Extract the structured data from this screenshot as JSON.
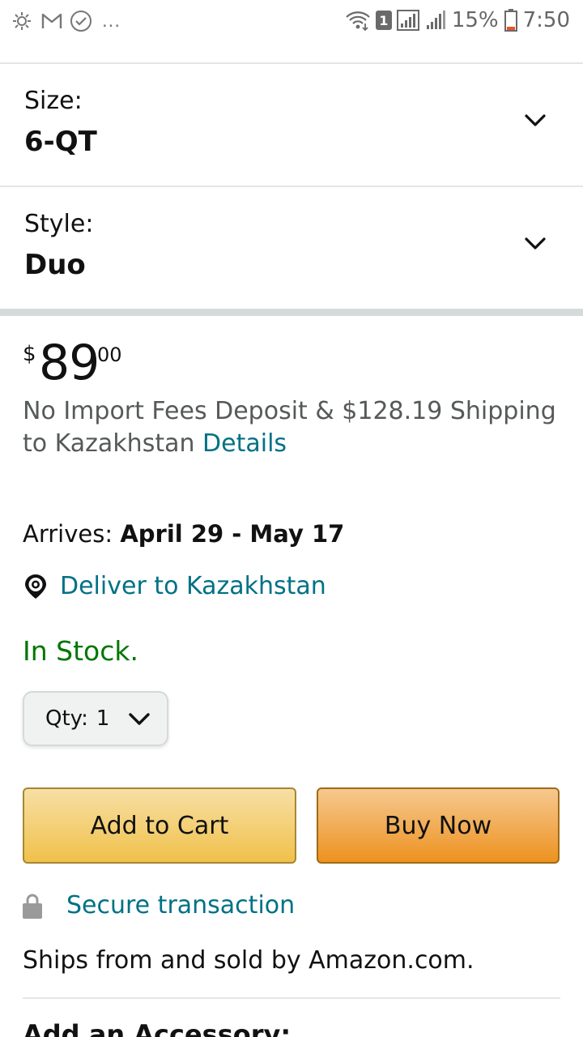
{
  "status_bar": {
    "notification_icons": [
      "weather-icon",
      "gmail-icon",
      "check-circle-icon"
    ],
    "overflow": "...",
    "sim_badge": "1",
    "battery_percent": "15%",
    "time": "7:50"
  },
  "size": {
    "label": "Size:",
    "value": "6-QT"
  },
  "style": {
    "label": "Style:",
    "value": "Duo"
  },
  "price": {
    "symbol": "$",
    "whole": "89",
    "fraction": "00"
  },
  "shipping": {
    "text": "No Import Fees Deposit & $128.19 Shipping to Kazakhstan",
    "details_link": "Details"
  },
  "arrives": {
    "label": "Arrives:",
    "dates": "April 29 - May 17"
  },
  "deliver_to": "Deliver to Kazakhstan",
  "stock_status": "In Stock.",
  "quantity": {
    "label": "Qty:",
    "value": "1"
  },
  "buttons": {
    "add_to_cart": "Add to Cart",
    "buy_now": "Buy Now"
  },
  "secure_transaction": "Secure transaction",
  "ships_from": "Ships from and sold by Amazon.com.",
  "accessory_heading": "Add an Accessory:",
  "colors": {
    "link": "#007185",
    "in_stock": "#007600",
    "add_to_cart_bg": "#f0c14b",
    "buy_now_bg": "#ed9220"
  }
}
